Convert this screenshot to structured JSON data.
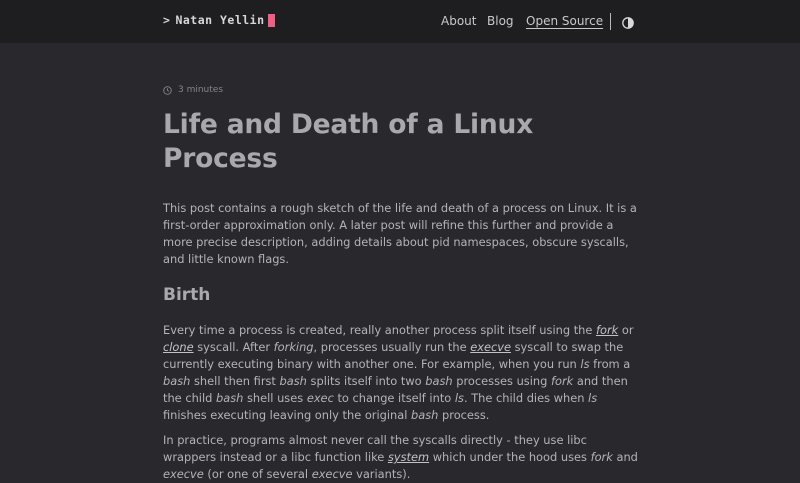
{
  "header": {
    "logo_prompt": ">",
    "logo_name": "Natan Yellin",
    "nav": {
      "about": "About",
      "blog": "Blog",
      "open_source": "Open Source"
    },
    "theme_toggle_icon": "contrast-icon"
  },
  "post": {
    "reading_time": "3 minutes",
    "title": "Life and Death of a Linux Process",
    "intro": "This post contains a rough sketch of the life and death of a process on Linux. It is a first-order approximation only. A later post will refine this further and provide a more precise description, adding details about pid namespaces, obscure syscalls, and little known flags.",
    "section_heading": "Birth",
    "p2": {
      "t1": "Every time a process is created, really another process split itself using the ",
      "fork_link": "fork",
      "t2": " or ",
      "clone_link": "clone",
      "t3": " syscall. After ",
      "forking": "forking",
      "t4": ", processes usually run the ",
      "execve_link": "execve",
      "t5": " syscall to swap the currently executing binary with another one. For example, when you run ",
      "ls1": "ls",
      "t6": " from a ",
      "bash1": "bash",
      "t7": " shell then first ",
      "bash2": "bash",
      "t8": " splits itself into two ",
      "bash3": "bash",
      "t9": " processes using ",
      "fork2": "fork",
      "t10": " and then the child ",
      "bash4": "bash",
      "t11": " shell uses ",
      "exec": "exec",
      "t12": " to change itself into ",
      "ls2": "ls",
      "t13": ". The child dies when ",
      "ls3": "ls",
      "t14": " finishes executing leaving only the original ",
      "bash5": "bash",
      "t15": " process."
    },
    "p3": {
      "t1": "In practice, programs almost never call the syscalls directly - they use libc wrappers instead or a libc function like ",
      "system_link": "system",
      "t2": " which under the hood uses ",
      "fork": "fork",
      "t3": " and ",
      "execve": "execve",
      "t4": " (or one of several ",
      "execve2": "execve",
      "t5": " variants)."
    }
  },
  "colors": {
    "page_bg": "#29292d",
    "header_bg": "#1e1e21",
    "cursor_accent": "#ef5f84"
  }
}
